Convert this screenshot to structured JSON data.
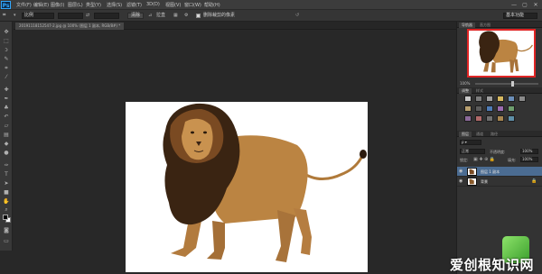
{
  "app": {
    "logo": "Ps"
  },
  "menu": [
    "文件(F)",
    "编辑(E)",
    "图像(I)",
    "图层(L)",
    "类型(Y)",
    "选择(S)",
    "滤镜(T)",
    "3D(D)",
    "视图(V)",
    "窗口(W)",
    "帮助(H)"
  ],
  "window_controls": [
    "—",
    "▢",
    "✕"
  ],
  "options": {
    "style_value": "比例",
    "clear_label": "清除",
    "straighten_label": "拉直",
    "delete_pixels_label": "删除裁剪的像素",
    "workspace_select": "基本功能"
  },
  "document": {
    "tab_label": "20191118152547-2.jpg @ 100% (图层 1 副本, RGB/8#) *"
  },
  "panels": {
    "navigator_tabs": [
      "导航器",
      "直方图"
    ],
    "zoom": "100%",
    "adjust_tabs": [
      "调整",
      "样式"
    ],
    "layer_tabs": [
      "图层",
      "通道",
      "路径"
    ],
    "blend_mode": "正常",
    "opacity_label": "不透明度:",
    "opacity_value": "100%",
    "lock_label": "锁定:",
    "fill_label": "填充:",
    "fill_value": "100%",
    "layers": [
      {
        "name": "图层 1 副本",
        "active": true
      },
      {
        "name": "背景",
        "active": false
      }
    ]
  },
  "watermark": {
    "text": "爱创根知识网"
  },
  "colors": {
    "accent": "#4b6c92",
    "nav_frame": "#e02525",
    "logo": "#31a8ff"
  }
}
